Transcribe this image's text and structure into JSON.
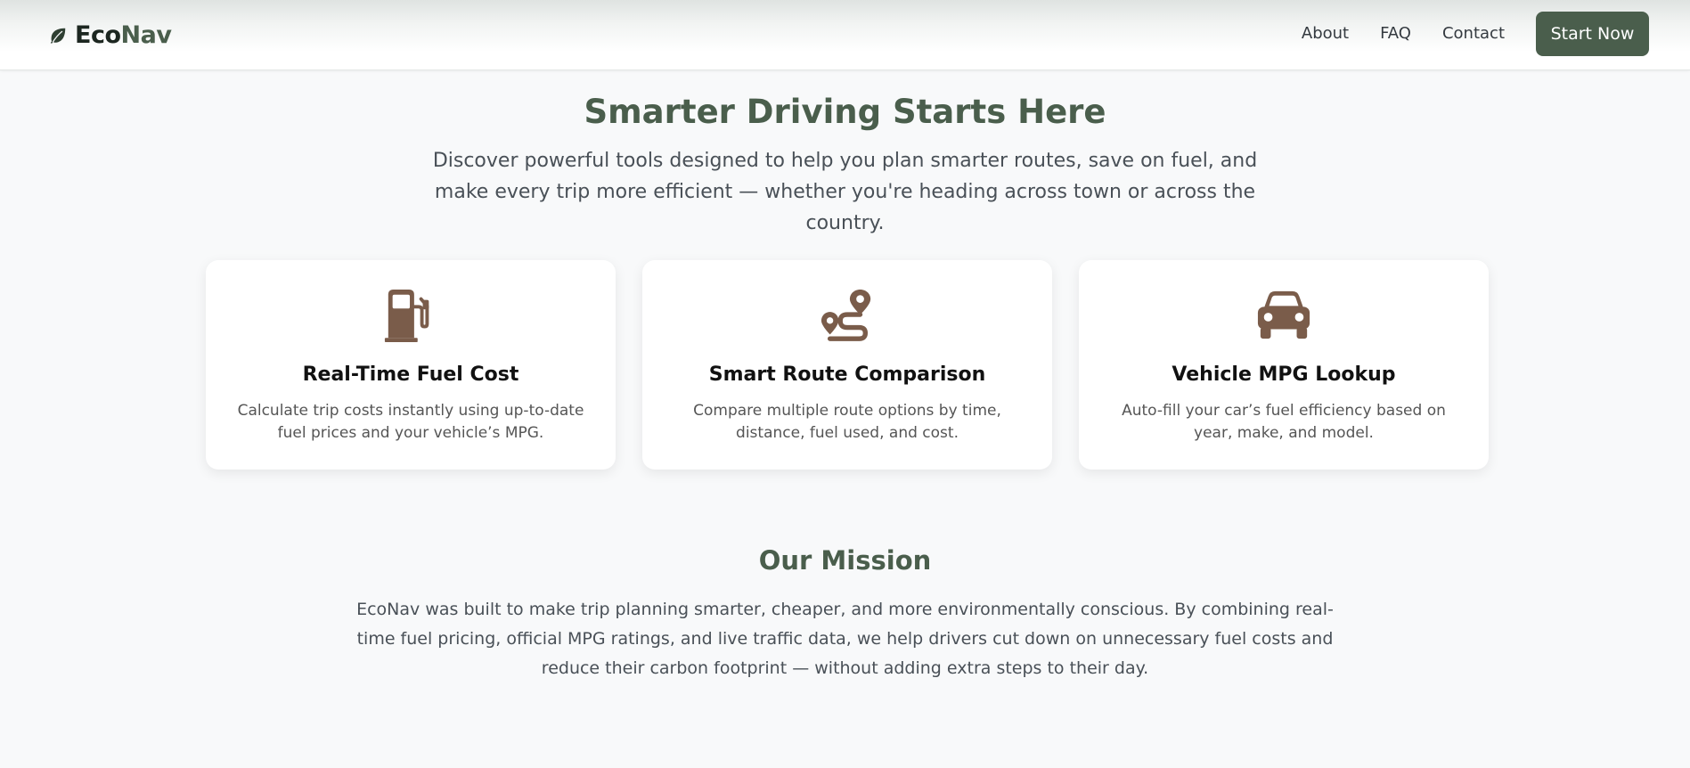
{
  "navbar": {
    "brand": {
      "eco": "Eco",
      "nav": "Nav",
      "icon": "leaf-icon"
    },
    "links": [
      "About",
      "FAQ",
      "Contact"
    ],
    "cta_label": "Start Now"
  },
  "hero": {
    "title": "Smarter Driving Starts Here",
    "subtitle": "Discover powerful tools designed to help you plan smarter routes, save on fuel, and make every trip more efficient — whether you're heading across town or across the country."
  },
  "features": [
    {
      "icon": "gas-pump-icon",
      "title": "Real-Time Fuel Cost",
      "text": "Calculate trip costs instantly using up-to-date fuel prices and your vehicle’s MPG."
    },
    {
      "icon": "route-icon",
      "title": "Smart Route Comparison",
      "text": "Compare multiple route options by time, distance, fuel used, and cost."
    },
    {
      "icon": "car-icon",
      "title": "Vehicle MPG Lookup",
      "text": "Auto-fill your car’s fuel efficiency based on year, make, and model."
    }
  ],
  "mission": {
    "title": "Our Mission",
    "text": "EcoNav was built to make trip planning smarter, cheaper, and more environmentally conscious. By combining real-time fuel pricing, official MPG ratings, and live traffic data, we help drivers cut down on unnecessary fuel costs and reduce their carbon footprint — without adding extra steps to their day."
  },
  "colors": {
    "primary": "#4a5e4c",
    "icon_brown": "#7a5c4a",
    "background": "#f8f9fa"
  }
}
